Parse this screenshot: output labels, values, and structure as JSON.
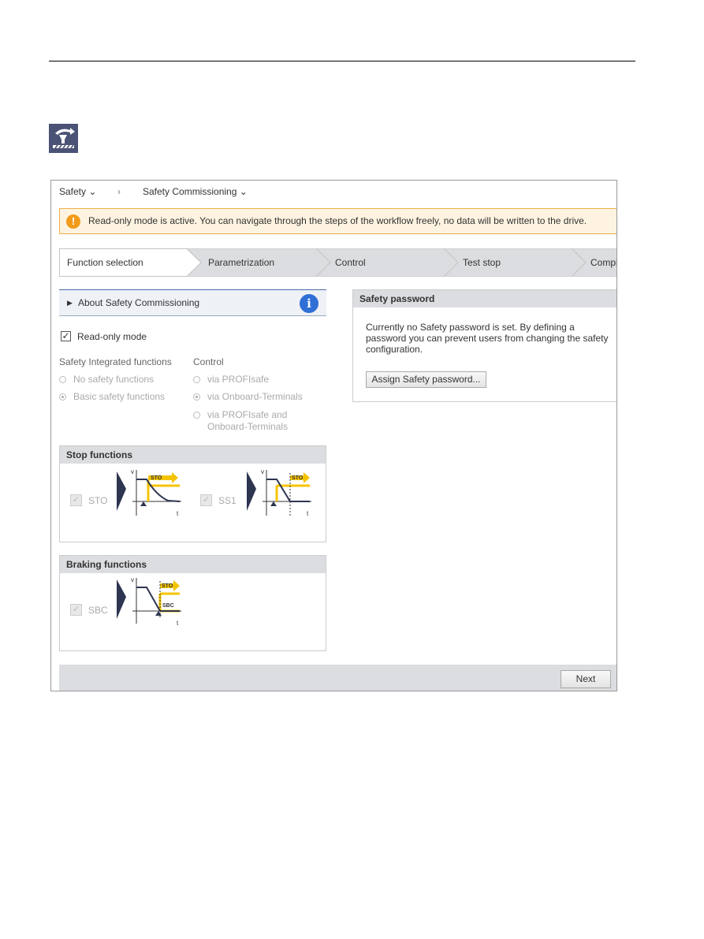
{
  "breadcrumb": {
    "item1": "Safety",
    "item2": "Safety Commissioning"
  },
  "banner": {
    "text": "Read-only mode is active. You can navigate through the steps of the workflow freely, no data will be written to the drive.",
    "icon": "warning-icon",
    "color": "#f29b1b"
  },
  "steps": [
    {
      "label": "Function selection",
      "active": true
    },
    {
      "label": "Parametrization"
    },
    {
      "label": "Control"
    },
    {
      "label": "Test stop"
    },
    {
      "label": "Compl"
    }
  ],
  "about": {
    "label": "About Safety Commissioning",
    "icon": "info-icon"
  },
  "readonly": {
    "label": "Read-only mode",
    "checked": true
  },
  "sif": {
    "title": "Safety Integrated functions",
    "options": [
      {
        "label": "No safety functions",
        "selected": false
      },
      {
        "label": "Basic safety functions",
        "selected": true
      }
    ]
  },
  "control": {
    "title": "Control",
    "options": [
      {
        "label": "via PROFIsafe",
        "selected": false
      },
      {
        "label": "via Onboard-Terminals",
        "selected": true
      },
      {
        "label": "via PROFIsafe and",
        "label2": "Onboard-Terminals",
        "selected": false
      }
    ]
  },
  "stop": {
    "title": "Stop functions",
    "items": [
      {
        "label": "STO",
        "diagram_label": "STO",
        "checked": true
      },
      {
        "label": "SS1",
        "diagram_label": "STO",
        "checked": true
      }
    ]
  },
  "braking": {
    "title": "Braking functions",
    "items": [
      {
        "label": "SBC",
        "diagram_label": "STO",
        "diagram_label2": "SBC",
        "checked": true
      }
    ]
  },
  "diagram": {
    "v": "v",
    "t": "t",
    "accent": "#f5c400"
  },
  "password": {
    "title": "Safety password",
    "text": "Currently no Safety password is set. By defining a password you can prevent users from changing the safety configuration.",
    "button": "Assign Safety password..."
  },
  "footer": {
    "next": "Next"
  }
}
